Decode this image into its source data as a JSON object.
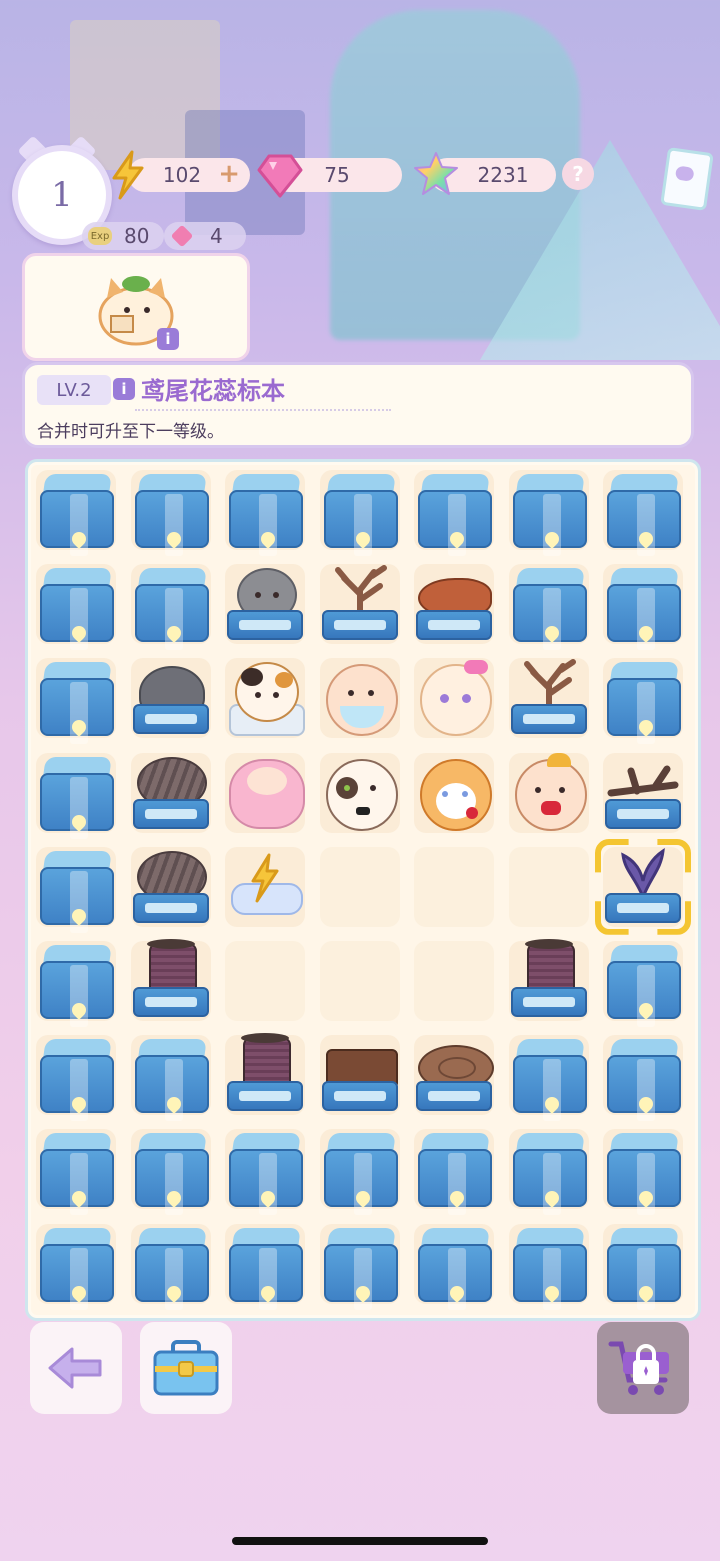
{
  "player": {
    "level": "1"
  },
  "resources": {
    "energy": "102",
    "energy_add": "+",
    "gems": "75",
    "stars": "2231",
    "help": "?"
  },
  "sub_resources": {
    "exp_tag": "Exp",
    "exp": "80",
    "hearts": "4"
  },
  "selected_item": {
    "info": "i",
    "level": "LV.2",
    "name": "鸢尾花蕊标本",
    "description": "合并时可升至下一等级。"
  },
  "board": {
    "rows": 9,
    "cols": 7,
    "cells": [
      [
        "crate",
        "crate",
        "crate",
        "crate",
        "crate",
        "crate",
        "crate"
      ],
      [
        "crate",
        "crate",
        "stone-doll",
        "coral",
        "fish",
        "crate",
        "crate"
      ],
      [
        "crate",
        "stone",
        "calico-cat",
        "hamster-diaper",
        "pink-bow-cat",
        "coral",
        "crate"
      ],
      [
        "crate",
        "yarn-bundle",
        "pink-bun",
        "siamese-cat",
        "orange-cat-rose",
        "hamster-hat",
        "branch"
      ],
      [
        "crate",
        "yarn-bundle",
        "lightning-cloud",
        "empty",
        "empty",
        "empty",
        "iris-specimen"
      ],
      [
        "crate",
        "thread-spool",
        "empty",
        "empty",
        "empty",
        "thread-spool",
        "crate"
      ],
      [
        "crate",
        "crate",
        "thread-spool",
        "chocolate",
        "wood-log",
        "crate",
        "crate"
      ],
      [
        "crate",
        "crate",
        "crate",
        "crate",
        "crate",
        "crate",
        "crate"
      ],
      [
        "crate",
        "crate",
        "crate",
        "crate",
        "crate",
        "crate",
        "crate"
      ]
    ],
    "selected": {
      "row": 4,
      "col": 6
    }
  },
  "colors": {
    "accent": "#9a6ad0",
    "highlight": "#f4c531",
    "crate": "#4a93d2"
  },
  "icons": {
    "energy": "lightning-icon",
    "gems": "pink-gem-icon",
    "stars": "rainbow-star-icon",
    "back": "back-arrow-icon",
    "toolbox": "toolbox-icon",
    "shop": "locked-cart-icon",
    "cards": "card-album-icon"
  }
}
